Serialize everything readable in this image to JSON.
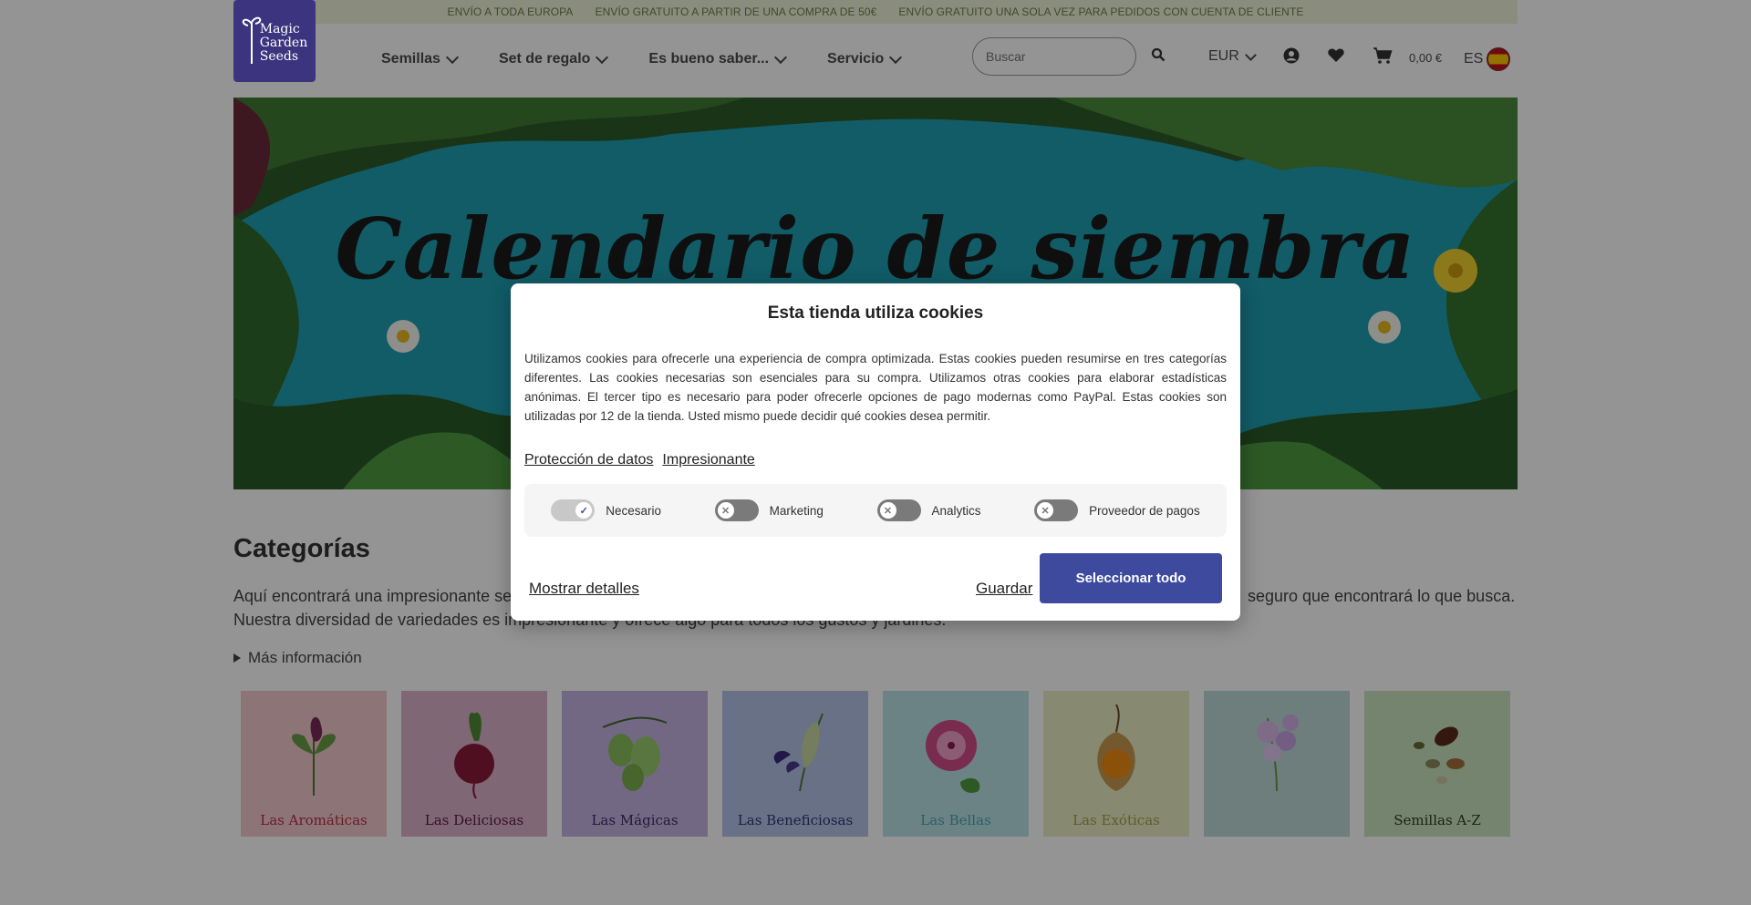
{
  "topbar": {
    "items": [
      "ENVÍO A TODA EUROPA",
      "ENVÍO GRATUITO A PARTIR DE UNA COMPRA DE 50€",
      "ENVÍO GRATUITO UNA SOLA VEZ PARA PEDIDOS CON CUENTA DE CLIENTE"
    ]
  },
  "header": {
    "logo_lines": [
      "Magic",
      "Garden",
      "Seeds"
    ],
    "nav": [
      "Semillas",
      "Set de regalo",
      "Es bueno saber...",
      "Servicio"
    ],
    "search_placeholder": "Buscar",
    "currency": "EUR",
    "cart_total": "0,00 €",
    "language": "ES",
    "icons": [
      "search-icon",
      "account-icon",
      "heart-icon",
      "cart-icon",
      "spain-flag-icon"
    ]
  },
  "hero": {
    "title": "Calendario de siembra"
  },
  "categories": {
    "heading": "Categorías",
    "desc_left_1": "Aquí encontrará una impresionante selec",
    "desc_right_1": "seguro que encontrará lo que busca.",
    "desc_line_2": "Nuestra diversidad de variedades es impresionante y ofrece algo para todos los gustos y jardines.",
    "more": "Más información",
    "tiles": [
      {
        "label": "Las Aromáticas",
        "bg": "#f3c9ce",
        "color": "#b5303f"
      },
      {
        "label": "Las Deliciosas",
        "bg": "#dcb2cc",
        "color": "#5a1a3c"
      },
      {
        "label": "Las Mágicas",
        "bg": "#c4b4e2",
        "color": "#3a2a6e"
      },
      {
        "label": "Las Beneficiosas",
        "bg": "#b4c3e6",
        "color": "#253a78"
      },
      {
        "label": "Las Bellas",
        "bg": "#b8e2e6",
        "color": "#4aa3b5"
      },
      {
        "label": "Las Exóticas",
        "bg": "#e9edc2",
        "color": "#a0a050"
      },
      {
        "label": "",
        "bg": "#bcd9d6",
        "color": "#3a6a66"
      },
      {
        "label": "Semillas A-Z",
        "bg": "#c9e4c0",
        "color": "#2b3e22"
      }
    ]
  },
  "cookie_modal": {
    "title": "Esta tienda utiliza cookies",
    "text": "Utilizamos cookies para ofrecerle una experiencia de compra optimizada. Estas cookies pueden resumirse en tres categorías diferentes. Las cookies necesarias son esenciales para su compra. Utilizamos otras cookies para elaborar estadísticas anónimas. El tercer tipo es necesario para poder ofrecerle opciones de pago modernas como PayPal. Estas cookies son utilizadas por 12 de la tienda. Usted mismo puede decidir qué cookies desea permitir.",
    "link_privacy": "Protección de datos",
    "link_imprint": "Impresionante",
    "toggles": [
      {
        "label": "Necesario",
        "on": true
      },
      {
        "label": "Marketing",
        "on": false
      },
      {
        "label": "Analytics",
        "on": false
      },
      {
        "label": "Proveedor de pagos",
        "on": false
      }
    ],
    "show_details": "Mostrar detalles",
    "save": "Guardar",
    "select_all": "Seleccionar todo"
  }
}
